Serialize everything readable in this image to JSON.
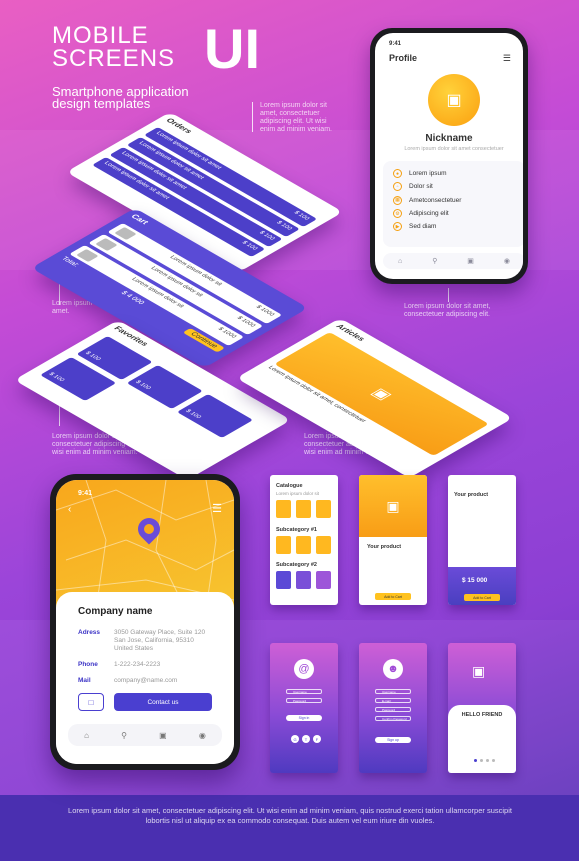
{
  "header": {
    "line1": "MOBILE",
    "line2": "SCREENS",
    "big": "UI",
    "subtitle1": "Smartphone application",
    "subtitle2": "design templates"
  },
  "notes": {
    "top_right": "Lorem ipsum dolor sit amet, consectetuer adipiscing elit. Ut wisi enim ad minim veniam.",
    "mid_left": "Lorem ipsum dolor sit amet.",
    "mid_right": "Lorem ipsum dolor sit amet, consectetuer adipiscing elit.",
    "low_left": "Lorem ipsum dolor sit amet, consectetuer adipiscing elit. Ut wisi enim ad minim veniam.",
    "low_right": "Lorem ipsum dolor sit amet, consectetuer adipiscing elit. Ut wisi enim ad minim veniam."
  },
  "iso_orders": {
    "title": "Orders",
    "rows": [
      {
        "text": "Lorem ipsum dolor sit amet",
        "price": "$ 100"
      },
      {
        "text": "Lorem ipsum dolor sit amet",
        "price": "$ 100"
      },
      {
        "text": "Lorem ipsum dolor sit amet",
        "price": "$ 100"
      },
      {
        "text": "Lorem ipsum dolor sit amet",
        "price": "$ 100"
      }
    ]
  },
  "iso_cart": {
    "title": "Cart",
    "items": [
      {
        "text": "Lorem ipsum dolor sit",
        "price": "$ 1000"
      },
      {
        "text": "Lorem ipsum dolor sit",
        "price": "$ 1000"
      },
      {
        "text": "Lorem ipsum dolor sit",
        "price": "$ 1000"
      }
    ],
    "total_label": "Total:",
    "total": "$ 4 000",
    "checkout": "Continue"
  },
  "iso_fav": {
    "title": "Favorites",
    "price": "$ 100"
  },
  "iso_articles": {
    "title": "Articles",
    "caption": "Lorem ipsum dolor sit amet, consectetuer"
  },
  "profile": {
    "time": "9:41",
    "title": "Profile",
    "menu_icon": "hamburger-icon",
    "name": "Nickname",
    "sub": "Lorem ipsum dolor sit amet consectetuer",
    "items": [
      "Lorem ipsum",
      "Dolor sit",
      "Ametconsectetuer",
      "Adipiscing elit",
      "Sed diam"
    ]
  },
  "map": {
    "time": "9:41",
    "company": "Company name",
    "address_label": "Adress",
    "address": "3050 Gateway Place, Suite 120 San Jose, California, 95310 United States",
    "phone_label": "Phone",
    "phone": "1-222-234-2223",
    "mail_label": "Mail",
    "mail": "company@name.com",
    "contact": "Contact us"
  },
  "small": {
    "catalogue": "Catalogue",
    "catalogue_sub": "Lorem ipsum dolor sit",
    "subcat1": "Subcategory #1",
    "subcat2": "Subcategory #2",
    "your_product": "Your product",
    "price": "$ 15 000",
    "add_to_cart": "Add to Cart",
    "username": "Username",
    "password": "Password",
    "email": "E-mail",
    "confirm": "Confirm Password",
    "sign_in": "Sign in",
    "sign_up": "Sign up",
    "hello": "HELLO FRIEND"
  },
  "footer": "Lorem ipsum dolor sit amet, consectetuer adipiscing elit. Ut wisi enim ad minim veniam, quis nostrud exerci tation ullamcorper suscipit lobortis nisl ut aliquip ex ea commodo consequat. Duis autem vel eum iriure din vuoles.",
  "colors": {
    "accent": "#4a3fd0",
    "orange": "#f8a71c",
    "pink": "#e95fc3"
  }
}
